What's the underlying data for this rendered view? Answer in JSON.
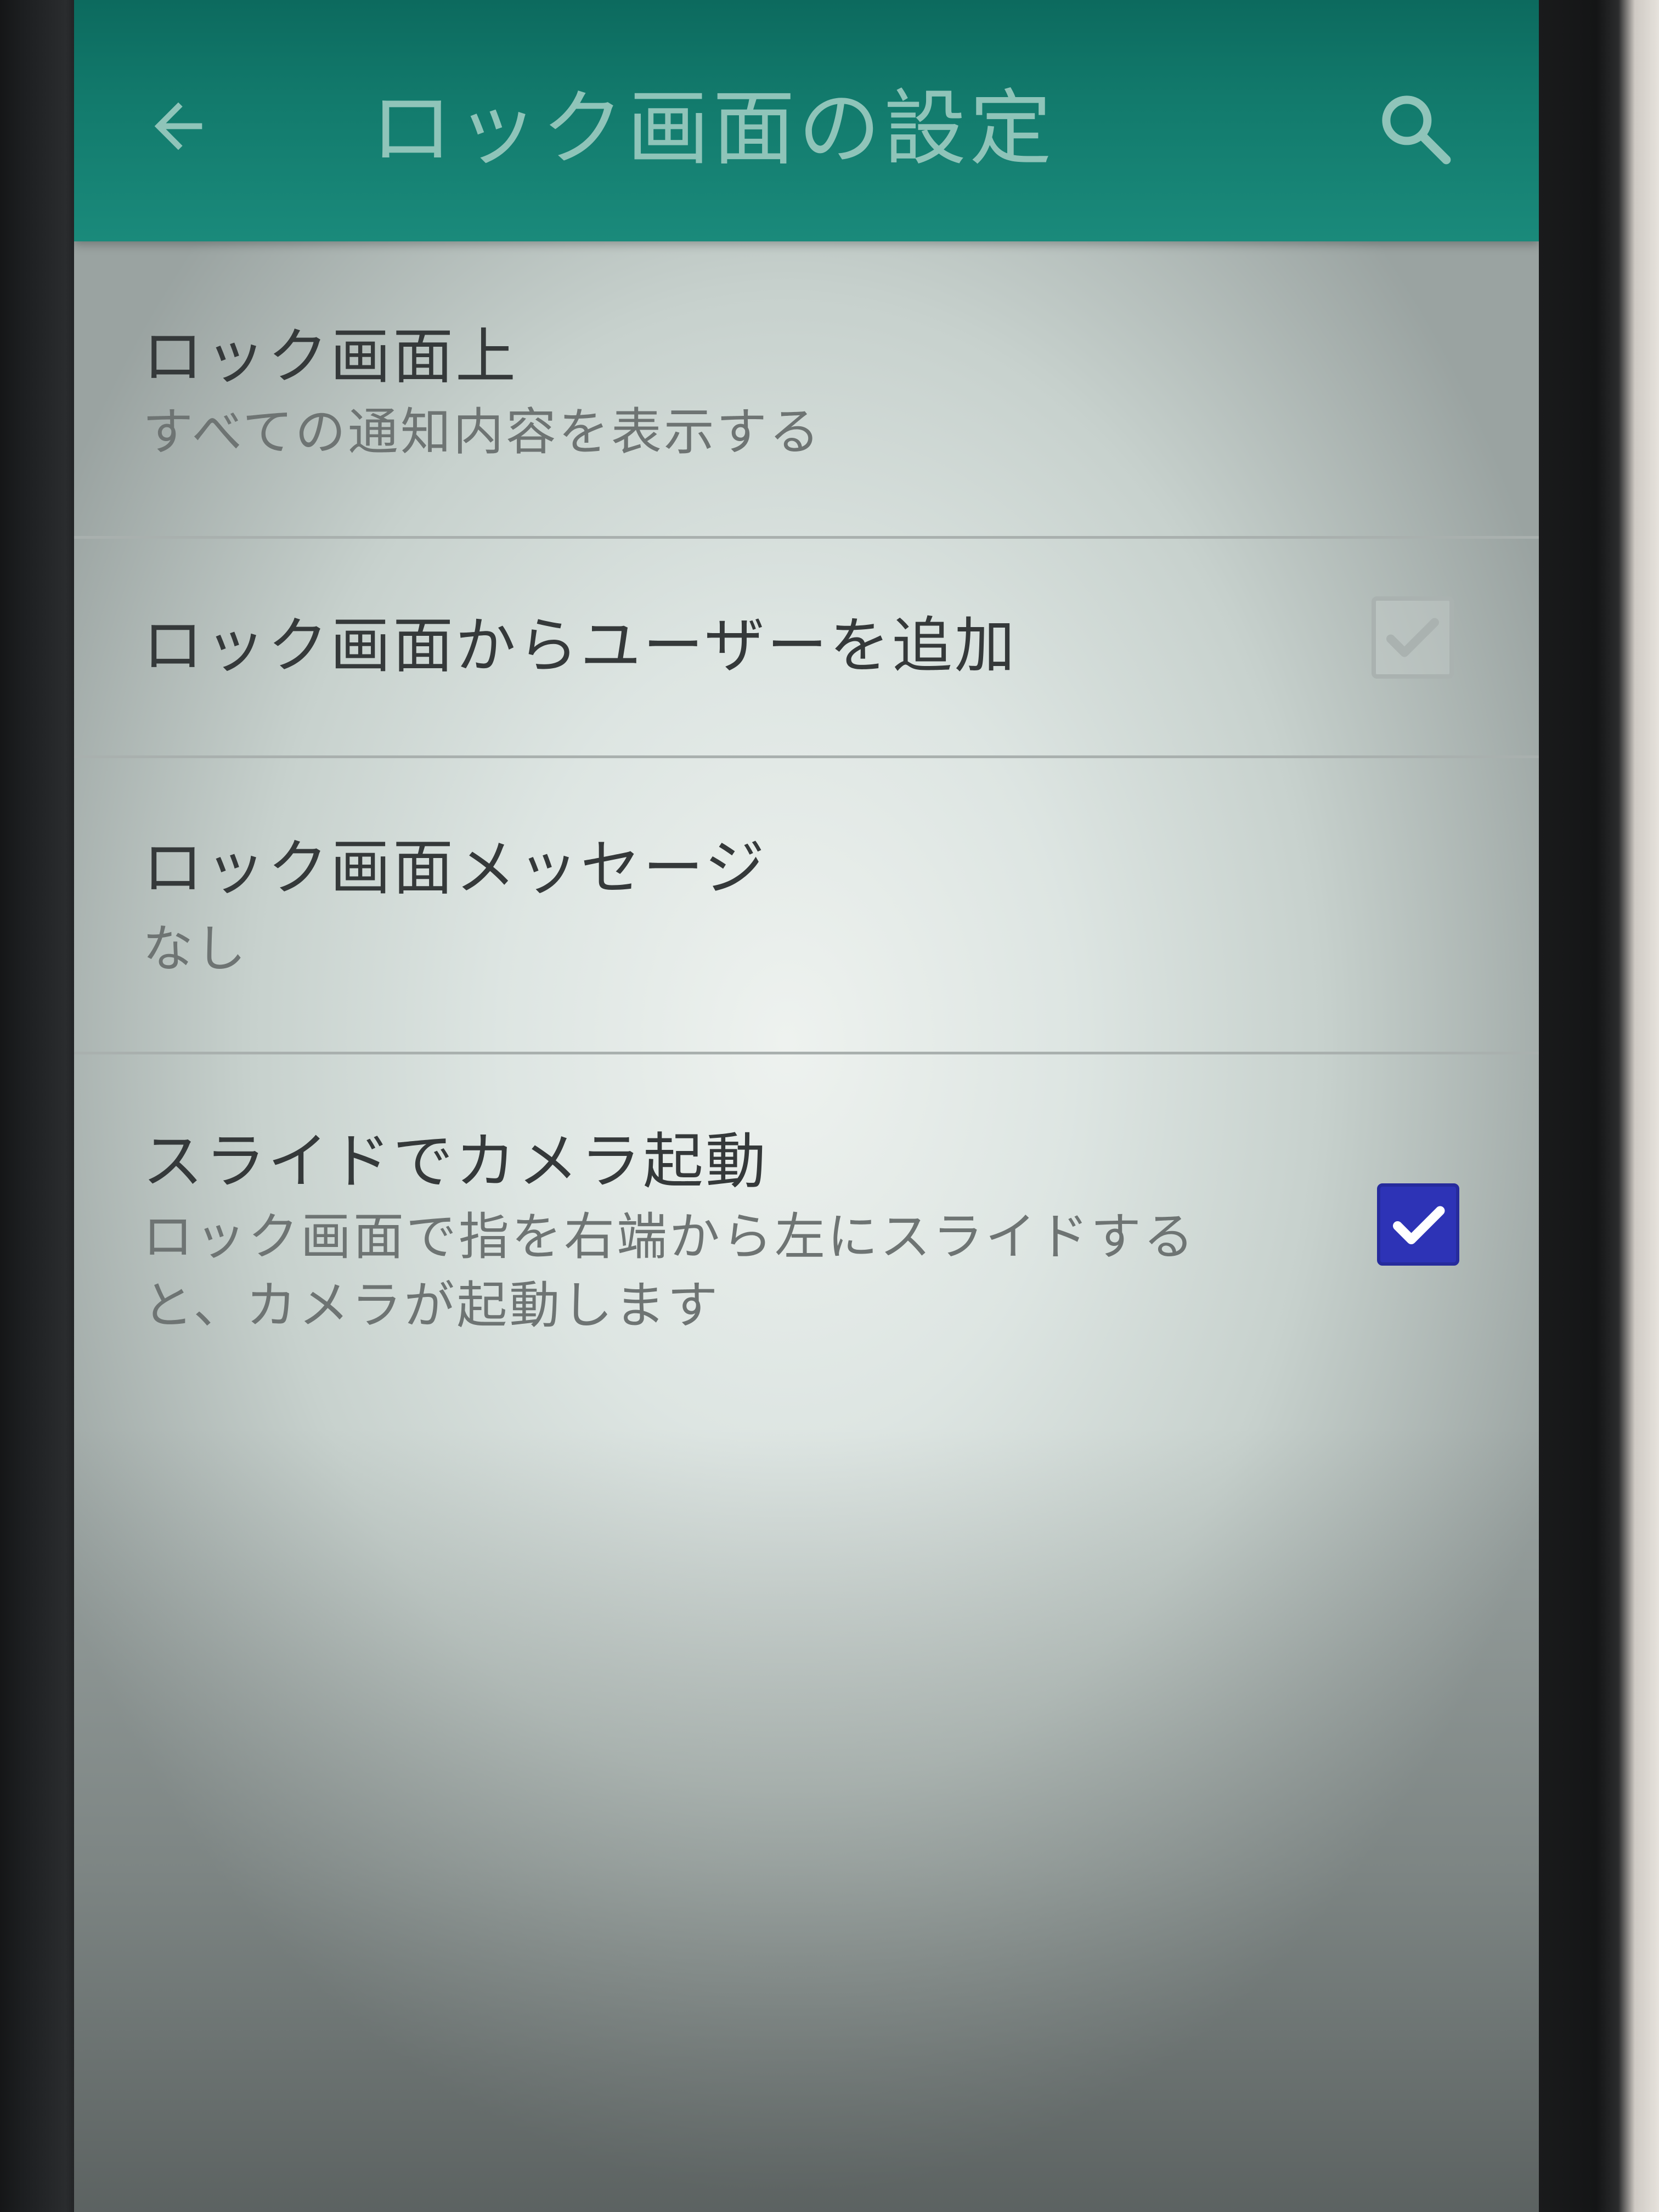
{
  "app_bar": {
    "title": "ロック画面の設定",
    "back_icon": "arrow-back-icon",
    "search_icon": "search-icon",
    "color": "#127a6c"
  },
  "prefs": [
    {
      "title": "ロック画面上",
      "summary": "すべての通知内容を表示する"
    },
    {
      "title": "ロック画面からユーザーを追加",
      "checkbox": {
        "checked": true,
        "enabled": false
      }
    },
    {
      "title": "ロック画面メッセージ",
      "summary": "なし"
    },
    {
      "title": "スライドでカメラ起動",
      "summary_line1": "ロック画面で指を右端から左にスライドする",
      "summary_line2": "と、カメラが起動します",
      "checkbox": {
        "checked": true,
        "enabled": true,
        "color": "#2d33b6"
      }
    }
  ]
}
